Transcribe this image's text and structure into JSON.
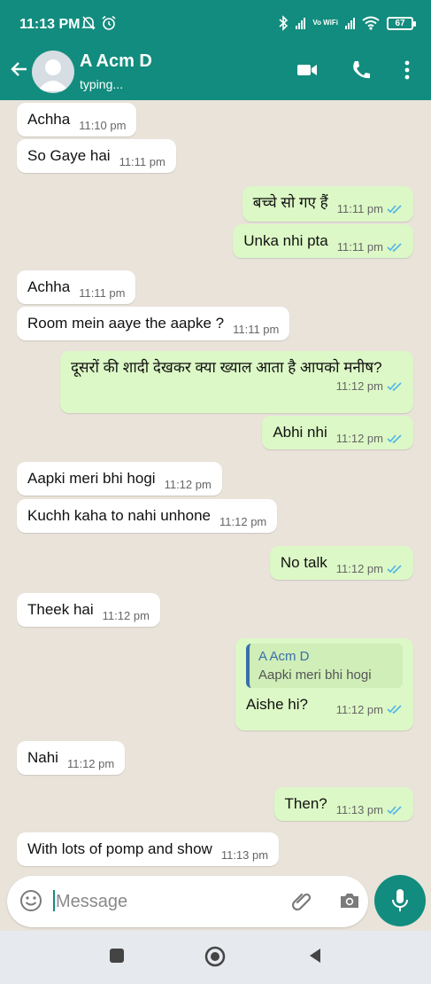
{
  "status_bar": {
    "time": "11:13 PM",
    "vowifi": "Vo WiFi",
    "battery": "67"
  },
  "header": {
    "contact_name": "A Acm D",
    "contact_status": "typing...",
    "icons": [
      "back-arrow-icon",
      "video-call-icon",
      "voice-call-icon",
      "more-options-icon"
    ],
    "color": "#128c7e"
  },
  "messages": [
    {
      "dir": "in",
      "text": "Achha",
      "time": "11:10 pm"
    },
    {
      "dir": "in",
      "text": "So Gaye hai",
      "time": "11:11 pm"
    },
    {
      "dir": "out",
      "text": "बच्चे सो गए हैं",
      "time": "11:11 pm"
    },
    {
      "dir": "out",
      "text": "Unka nhi pta",
      "time": "11:11 pm"
    },
    {
      "dir": "in",
      "text": "Achha",
      "time": "11:11 pm"
    },
    {
      "dir": "in",
      "text": "Room mein aaye the aapke ?",
      "time": "11:11 pm"
    },
    {
      "dir": "out",
      "text": "दूसरों की शादी देखकर क्या ख्याल आता है आपको मनीष?",
      "time": "11:12 pm"
    },
    {
      "dir": "out",
      "text": "Abhi nhi",
      "time": "11:12 pm"
    },
    {
      "dir": "in",
      "text": "Aapki meri bhi hogi",
      "time": "11:12 pm"
    },
    {
      "dir": "in",
      "text": "Kuchh kaha to nahi unhone",
      "time": "11:12 pm"
    },
    {
      "dir": "out",
      "text": "No talk",
      "time": "11:12 pm"
    },
    {
      "dir": "in",
      "text": "Theek hai",
      "time": "11:12 pm"
    },
    {
      "dir": "out",
      "text": "Aishe hi?",
      "time": "11:12 pm",
      "quote": {
        "name": "A Acm D",
        "text": "Aapki meri bhi hogi"
      }
    },
    {
      "dir": "in",
      "text": "Nahi",
      "time": "11:12 pm"
    },
    {
      "dir": "out",
      "text": "Then?",
      "time": "11:13 pm"
    },
    {
      "dir": "in",
      "text": "With lots of pomp and show",
      "time": "11:13 pm"
    }
  ],
  "composer": {
    "placeholder": "Message",
    "icons": [
      "emoji-icon",
      "attach-icon",
      "camera-icon",
      "mic-icon"
    ]
  },
  "colors": {
    "incoming": "#ffffff",
    "outgoing": "#dcf8c6",
    "read_tick": "#4fb5e8",
    "background": "#e9e3da"
  }
}
